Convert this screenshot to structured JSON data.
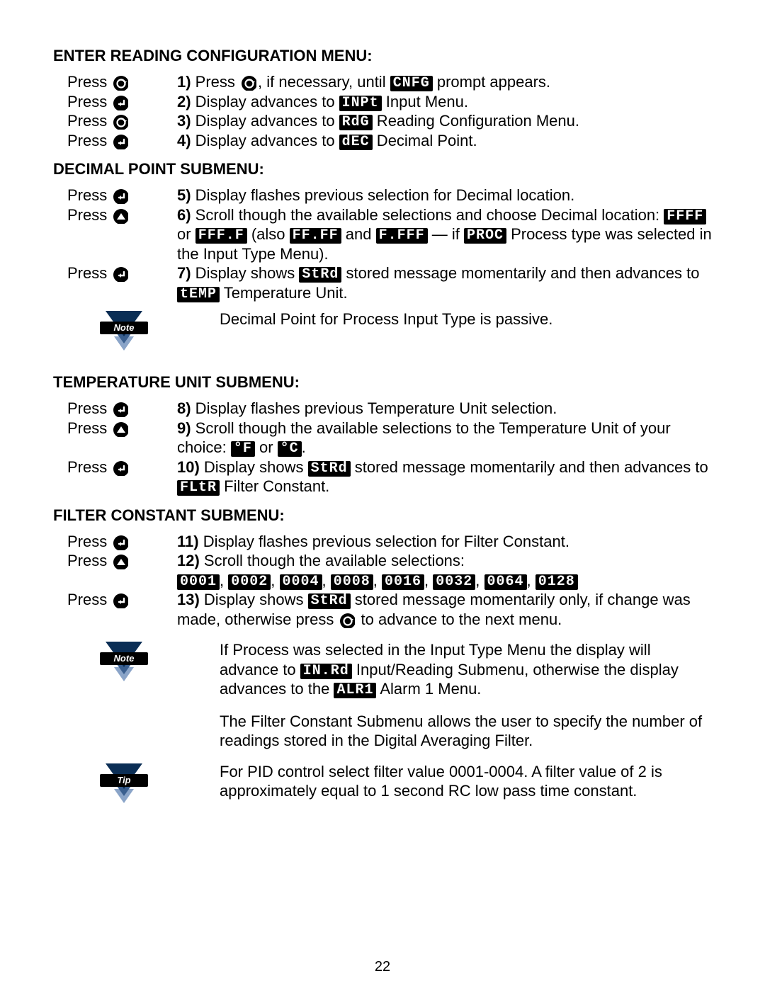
{
  "page_number": "22",
  "headings": {
    "h1": "ENTER READING CONFIGURATION MENU:",
    "h2": "DECIMAL POINT SUBMENU:",
    "h3": "TEMPERATURE UNIT SUBMENU:",
    "h4": "FILTER CONSTANT SUBMENU:"
  },
  "press": "Press",
  "steps": {
    "s1a": "1)",
    "s1b": " Press ",
    "s1c": ", if necessary, until ",
    "s1d": " prompt appears.",
    "s2a": "2)",
    "s2b": " Display advances to ",
    "s2c": " Input Menu.",
    "s3a": "3)",
    "s3b": " Display advances to ",
    "s3c": " Reading Configuration Menu.",
    "s4a": "4)",
    "s4b": " Display advances to ",
    "s4c": " Decimal Point.",
    "s5a": "5)",
    "s5b": " Display flashes previous selection for Decimal location.",
    "s6a": "6)",
    "s6b": " Scroll though the available selections and choose Decimal location: ",
    "s6c": " or ",
    "s6d": " (also ",
    "s6e": " and ",
    "s6f": " — if ",
    "s6g": " Process type was selected in the Input Type Menu).",
    "s7a": "7)",
    "s7b": " Display shows ",
    "s7c": " stored message momentarily and then advances to ",
    "s7d": " Temperature Unit.",
    "s8a": "8)",
    "s8b": " Display flashes previous Temperature Unit selection.",
    "s9a": "9)",
    "s9b": " Scroll though the available selections to the Temperature Unit of your choice: ",
    "s9c": " or ",
    "s9d": ".",
    "s10a": "10)",
    "s10b": " Display shows ",
    "s10c": " stored message momentarily and then advances to ",
    "s10d": " Filter Constant.",
    "s11a": "11)",
    "s11b": " Display flashes previous selection for Filter Constant.",
    "s12a": "12)",
    "s12b": " Scroll though the available selections:",
    "s13a": "13)",
    "s13b": " Display shows ",
    "s13c": " stored message momentarily only, if change was made, otherwise press ",
    "s13d": " to advance to the next menu."
  },
  "seg": {
    "cnfg": "CNFG",
    "inpt": "INPt",
    "rdg": "RdG",
    "dec": "dEC",
    "ffff": "FFFF",
    "fff_f": "FFF.F",
    "ff_ff": "FF.FF",
    "f_fff": "F.FFF",
    "proc": "PROC",
    "strd": "StRd",
    "temp": "tEMP",
    "degF": "°F",
    "degC": "°C",
    "fltr": "FLtR",
    "f0001": "0001",
    "f0002": "0002",
    "f0004": "0004",
    "f0008": "0008",
    "f0016": "0016",
    "f0032": "0032",
    "f0064": "0064",
    "f0128": "0128",
    "inrd": "IN.Rd",
    "alr1": "ALR1"
  },
  "notes": {
    "note_label": "Note",
    "tip_label": "Tip",
    "n1": "Decimal Point for Process Input Type is passive.",
    "n2a": "If Process was selected in the Input Type Menu the display will advance to ",
    "n2b": " Input/Reading Submenu, otherwise the display advances to the ",
    "n2c": " Alarm 1 Menu.",
    "n3": "The Filter Constant Submenu allows the user to specify the number of readings stored in the Digital Averaging Filter.",
    "n4": "For PID control select filter value 0001-0004. A filter value of 2 is approximately equal to 1 second RC low pass time constant."
  },
  "sep": ", "
}
